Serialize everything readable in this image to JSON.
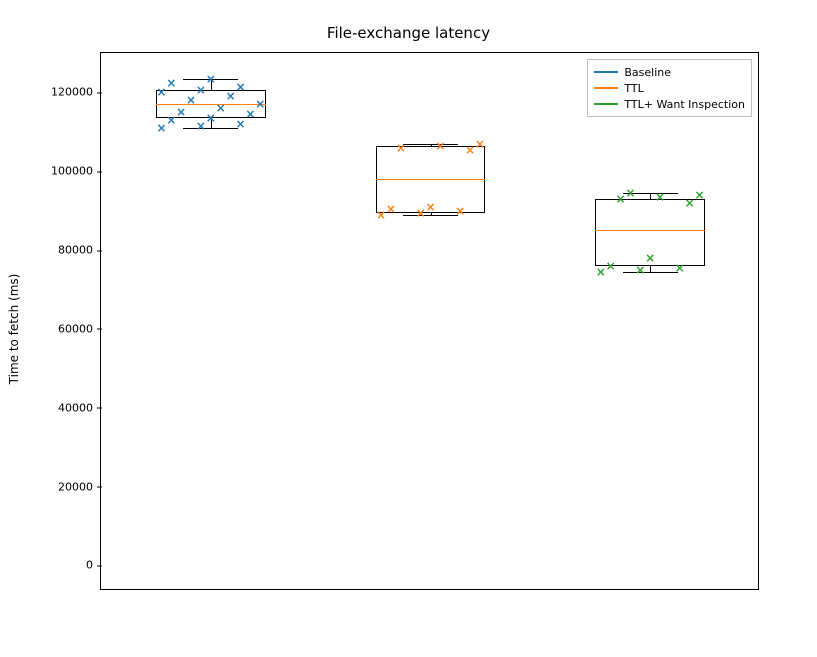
{
  "chart_data": {
    "type": "box",
    "title": "File-exchange latency",
    "xlabel": "",
    "ylabel": "Time to fetch (ms)",
    "ylim": [
      -6500,
      130000
    ],
    "yticks": [
      0,
      20000,
      40000,
      60000,
      80000,
      100000,
      120000
    ],
    "ytick_labels": [
      "0",
      "20000",
      "40000",
      "60000",
      "80000",
      "100000",
      "120000"
    ],
    "categories": [
      "Baseline",
      "TTL",
      "TTL+ Want Inspection"
    ],
    "series": [
      {
        "name": "Baseline",
        "color": "#1f77b4",
        "box": {
          "q1": 113500,
          "median": 117000,
          "q3": 120500,
          "whisker_low": 111000,
          "whisker_high": 123500
        },
        "points": [
          111000,
          111500,
          112000,
          113000,
          113500,
          114500,
          115000,
          116000,
          117000,
          118000,
          119000,
          120000,
          120500,
          121500,
          122500,
          123500
        ]
      },
      {
        "name": "TTL",
        "color": "#ff7f0e",
        "box": {
          "q1": 89500,
          "median": 98000,
          "q3": 106500,
          "whisker_low": 89000,
          "whisker_high": 107000
        },
        "points": [
          89000,
          89500,
          90000,
          90500,
          91000,
          105500,
          106000,
          106500,
          107000
        ]
      },
      {
        "name": "TTL+ Want Inspection",
        "color": "#2ca02c",
        "box": {
          "q1": 76000,
          "median": 85000,
          "q3": 93000,
          "whisker_low": 74500,
          "whisker_high": 94500
        },
        "points": [
          74500,
          75000,
          75500,
          76000,
          78000,
          92000,
          93000,
          93500,
          94000,
          94500
        ]
      }
    ],
    "legend": [
      "Baseline",
      "TTL",
      "TTL+ Want Inspection"
    ],
    "legend_loc": "upper right"
  }
}
